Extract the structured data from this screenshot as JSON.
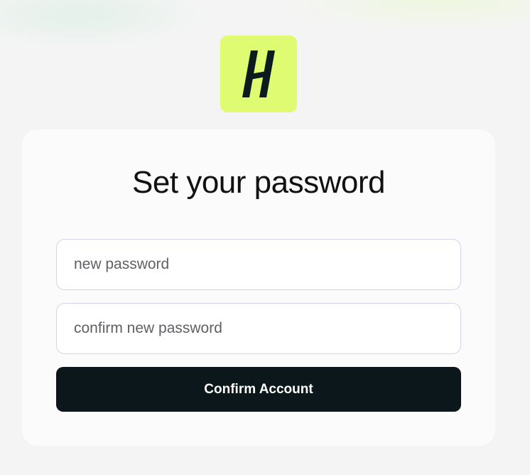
{
  "theme": {
    "background": "#f4f4f4",
    "card_background": "#fbfbfb",
    "logo_background": "#dffb72",
    "logo_mark": "#0b1a1c",
    "button_background": "#0b171b",
    "button_text": "#ffffff"
  },
  "logo": {
    "icon": "h-monogram-icon"
  },
  "form": {
    "title": "Set your password",
    "new_password_placeholder": "new password",
    "confirm_password_placeholder": "confirm new password",
    "submit_label": "Confirm Account"
  }
}
